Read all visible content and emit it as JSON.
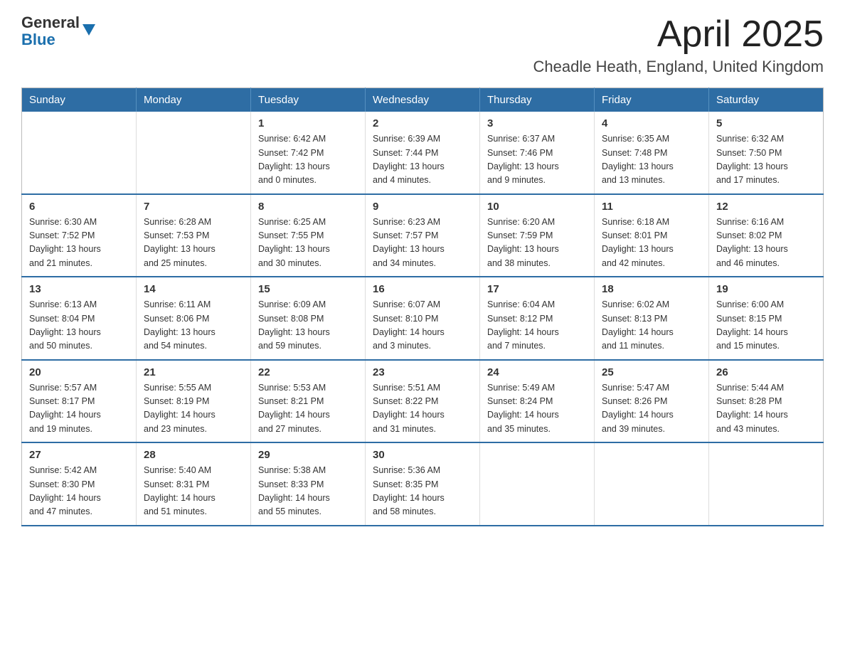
{
  "logo": {
    "general": "General",
    "blue": "Blue"
  },
  "title": "April 2025",
  "subtitle": "Cheadle Heath, England, United Kingdom",
  "days_of_week": [
    "Sunday",
    "Monday",
    "Tuesday",
    "Wednesday",
    "Thursday",
    "Friday",
    "Saturday"
  ],
  "weeks": [
    [
      {
        "day": "",
        "info": ""
      },
      {
        "day": "",
        "info": ""
      },
      {
        "day": "1",
        "info": "Sunrise: 6:42 AM\nSunset: 7:42 PM\nDaylight: 13 hours\nand 0 minutes."
      },
      {
        "day": "2",
        "info": "Sunrise: 6:39 AM\nSunset: 7:44 PM\nDaylight: 13 hours\nand 4 minutes."
      },
      {
        "day": "3",
        "info": "Sunrise: 6:37 AM\nSunset: 7:46 PM\nDaylight: 13 hours\nand 9 minutes."
      },
      {
        "day": "4",
        "info": "Sunrise: 6:35 AM\nSunset: 7:48 PM\nDaylight: 13 hours\nand 13 minutes."
      },
      {
        "day": "5",
        "info": "Sunrise: 6:32 AM\nSunset: 7:50 PM\nDaylight: 13 hours\nand 17 minutes."
      }
    ],
    [
      {
        "day": "6",
        "info": "Sunrise: 6:30 AM\nSunset: 7:52 PM\nDaylight: 13 hours\nand 21 minutes."
      },
      {
        "day": "7",
        "info": "Sunrise: 6:28 AM\nSunset: 7:53 PM\nDaylight: 13 hours\nand 25 minutes."
      },
      {
        "day": "8",
        "info": "Sunrise: 6:25 AM\nSunset: 7:55 PM\nDaylight: 13 hours\nand 30 minutes."
      },
      {
        "day": "9",
        "info": "Sunrise: 6:23 AM\nSunset: 7:57 PM\nDaylight: 13 hours\nand 34 minutes."
      },
      {
        "day": "10",
        "info": "Sunrise: 6:20 AM\nSunset: 7:59 PM\nDaylight: 13 hours\nand 38 minutes."
      },
      {
        "day": "11",
        "info": "Sunrise: 6:18 AM\nSunset: 8:01 PM\nDaylight: 13 hours\nand 42 minutes."
      },
      {
        "day": "12",
        "info": "Sunrise: 6:16 AM\nSunset: 8:02 PM\nDaylight: 13 hours\nand 46 minutes."
      }
    ],
    [
      {
        "day": "13",
        "info": "Sunrise: 6:13 AM\nSunset: 8:04 PM\nDaylight: 13 hours\nand 50 minutes."
      },
      {
        "day": "14",
        "info": "Sunrise: 6:11 AM\nSunset: 8:06 PM\nDaylight: 13 hours\nand 54 minutes."
      },
      {
        "day": "15",
        "info": "Sunrise: 6:09 AM\nSunset: 8:08 PM\nDaylight: 13 hours\nand 59 minutes."
      },
      {
        "day": "16",
        "info": "Sunrise: 6:07 AM\nSunset: 8:10 PM\nDaylight: 14 hours\nand 3 minutes."
      },
      {
        "day": "17",
        "info": "Sunrise: 6:04 AM\nSunset: 8:12 PM\nDaylight: 14 hours\nand 7 minutes."
      },
      {
        "day": "18",
        "info": "Sunrise: 6:02 AM\nSunset: 8:13 PM\nDaylight: 14 hours\nand 11 minutes."
      },
      {
        "day": "19",
        "info": "Sunrise: 6:00 AM\nSunset: 8:15 PM\nDaylight: 14 hours\nand 15 minutes."
      }
    ],
    [
      {
        "day": "20",
        "info": "Sunrise: 5:57 AM\nSunset: 8:17 PM\nDaylight: 14 hours\nand 19 minutes."
      },
      {
        "day": "21",
        "info": "Sunrise: 5:55 AM\nSunset: 8:19 PM\nDaylight: 14 hours\nand 23 minutes."
      },
      {
        "day": "22",
        "info": "Sunrise: 5:53 AM\nSunset: 8:21 PM\nDaylight: 14 hours\nand 27 minutes."
      },
      {
        "day": "23",
        "info": "Sunrise: 5:51 AM\nSunset: 8:22 PM\nDaylight: 14 hours\nand 31 minutes."
      },
      {
        "day": "24",
        "info": "Sunrise: 5:49 AM\nSunset: 8:24 PM\nDaylight: 14 hours\nand 35 minutes."
      },
      {
        "day": "25",
        "info": "Sunrise: 5:47 AM\nSunset: 8:26 PM\nDaylight: 14 hours\nand 39 minutes."
      },
      {
        "day": "26",
        "info": "Sunrise: 5:44 AM\nSunset: 8:28 PM\nDaylight: 14 hours\nand 43 minutes."
      }
    ],
    [
      {
        "day": "27",
        "info": "Sunrise: 5:42 AM\nSunset: 8:30 PM\nDaylight: 14 hours\nand 47 minutes."
      },
      {
        "day": "28",
        "info": "Sunrise: 5:40 AM\nSunset: 8:31 PM\nDaylight: 14 hours\nand 51 minutes."
      },
      {
        "day": "29",
        "info": "Sunrise: 5:38 AM\nSunset: 8:33 PM\nDaylight: 14 hours\nand 55 minutes."
      },
      {
        "day": "30",
        "info": "Sunrise: 5:36 AM\nSunset: 8:35 PM\nDaylight: 14 hours\nand 58 minutes."
      },
      {
        "day": "",
        "info": ""
      },
      {
        "day": "",
        "info": ""
      },
      {
        "day": "",
        "info": ""
      }
    ]
  ]
}
